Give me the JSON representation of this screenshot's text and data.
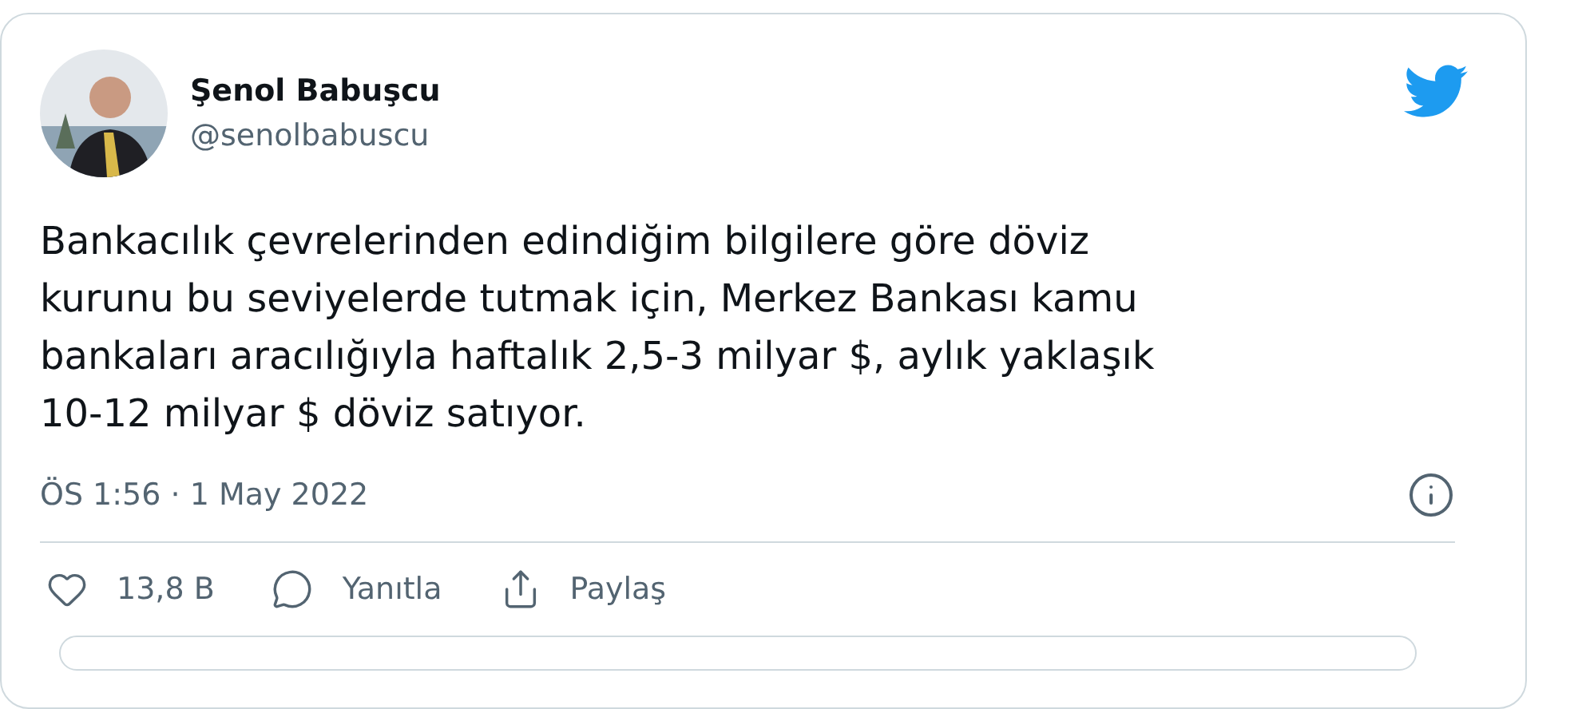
{
  "tweet": {
    "author": {
      "name": "Şenol Babuşcu",
      "handle": "@senolbabuscu"
    },
    "text_lines": [
      "Bankacılık çevrelerinden edindiğim bilgilere göre döviz",
      "kurunu bu seviyelerde tutmak için, Merkez Bankası kamu",
      "bankaları aracılığıyla haftalık 2,5-3 milyar $, aylık yaklaşık",
      "10-12 milyar $ döviz satıyor."
    ],
    "timestamp": "ÖS 1:56 · 1 May 2022",
    "actions": [
      {
        "kind": "like",
        "label": "13,8 B"
      },
      {
        "kind": "reply",
        "label": "Yanıtla"
      },
      {
        "kind": "share",
        "label": "Paylaş"
      }
    ]
  }
}
